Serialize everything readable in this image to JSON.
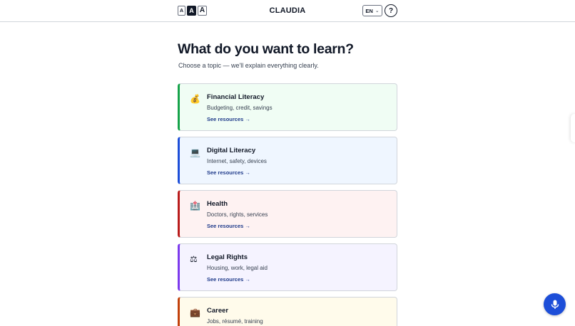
{
  "header": {
    "font_sizes": [
      "A",
      "A",
      "A"
    ],
    "app_title": "CLAUDIA",
    "language": "EN",
    "help": "?"
  },
  "main": {
    "heading": "What do you want to learn?",
    "subheading": "Choose a topic — we'll explain everything clearly.",
    "topics": [
      {
        "icon": "money-bag-icon",
        "glyph": "💰",
        "title": "Financial Literacy",
        "description": "Budgeting, credit, savings",
        "link": "See resources →",
        "accent": "#16a34a",
        "background": "#f0fdf4"
      },
      {
        "icon": "laptop-icon",
        "glyph": "💻",
        "title": "Digital Literacy",
        "description": "Internet, safety, devices",
        "link": "See resources →",
        "accent": "#1d4ed8",
        "background": "#eff6ff"
      },
      {
        "icon": "hospital-icon",
        "glyph": "🏥",
        "title": "Health",
        "description": "Doctors, rights, services",
        "link": "See resources →",
        "accent": "#b91c1c",
        "background": "#fef2f2"
      },
      {
        "icon": "scales-icon",
        "glyph": "⚖",
        "title": "Legal Rights",
        "description": "Housing, work, legal aid",
        "link": "See resources →",
        "accent": "#7c3aed",
        "background": "#f5f3ff"
      },
      {
        "icon": "briefcase-icon",
        "glyph": "💼",
        "title": "Career",
        "description": "Jobs, résumé, training",
        "link": "",
        "accent": "#c2410c",
        "background": "#fffbeb"
      }
    ]
  },
  "voice_button": {
    "icon": "microphone-icon",
    "color": "#1d4ed8"
  }
}
